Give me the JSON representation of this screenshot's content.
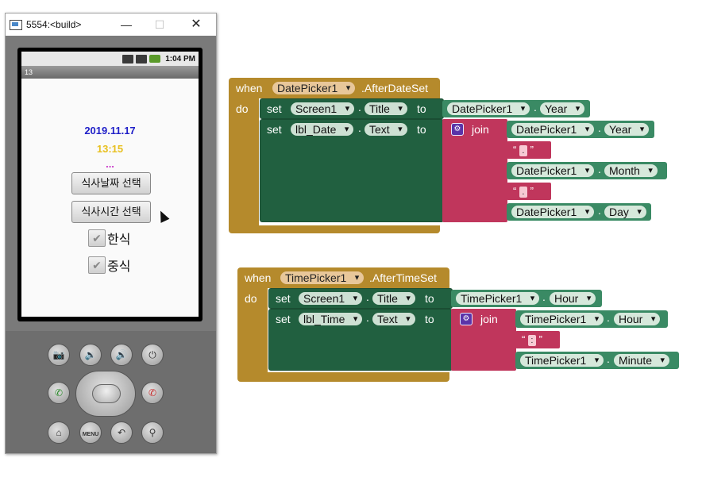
{
  "window": {
    "title": "5554:<build>",
    "min_glyph": "—",
    "max_glyph": "☐",
    "close_glyph": "✕"
  },
  "statusbar": {
    "time": "1:04 PM"
  },
  "app": {
    "title": "13"
  },
  "screen": {
    "date_value": "2019.11.17",
    "time_value": "13:15",
    "dots": "...",
    "date_button": "식사날짜 선택",
    "time_button": "식사시간 선택",
    "check1": "한식",
    "check2": "중식"
  },
  "keypad": {
    "camera": "📷",
    "vol_down": "🔉",
    "vol_up": "🔊",
    "power": "⏻",
    "call": "✆",
    "end": "✆",
    "home": "⌂",
    "menu": "MENU",
    "back": "↶",
    "search": "⚲"
  },
  "blocks": {
    "when": "when",
    "do": "do",
    "set": "set",
    "to": "to",
    "join": "join",
    "dot": ".",
    "event1": {
      "component": "DatePicker1",
      "event": ".AfterDateSet",
      "set1": {
        "component": "Screen1",
        "property": "Title",
        "value_component": "DatePicker1",
        "value_property": "Year"
      },
      "set2": {
        "component": "lbl_Date",
        "property": "Text"
      },
      "join_items": [
        {
          "component": "DatePicker1",
          "property": "Year"
        },
        {
          "text": "."
        },
        {
          "component": "DatePicker1",
          "property": "Month"
        },
        {
          "text": "."
        },
        {
          "component": "DatePicker1",
          "property": "Day"
        }
      ]
    },
    "event2": {
      "component": "TimePicker1",
      "event": ".AfterTimeSet",
      "set1": {
        "component": "Screen1",
        "property": "Title",
        "value_component": "TimePicker1",
        "value_property": "Hour"
      },
      "set2": {
        "component": "lbl_Time",
        "property": "Text"
      },
      "join_items": [
        {
          "component": "TimePicker1",
          "property": "Hour"
        },
        {
          "text": ":"
        },
        {
          "component": "TimePicker1",
          "property": "Minute"
        }
      ]
    }
  },
  "colors": {
    "event": "#b58a2c",
    "set": "#216040",
    "join": "#c0365c",
    "getter": "#3a8a64",
    "date_label": "#1f1fc8",
    "time_label": "#e8c020",
    "dots": "#c832c8"
  }
}
